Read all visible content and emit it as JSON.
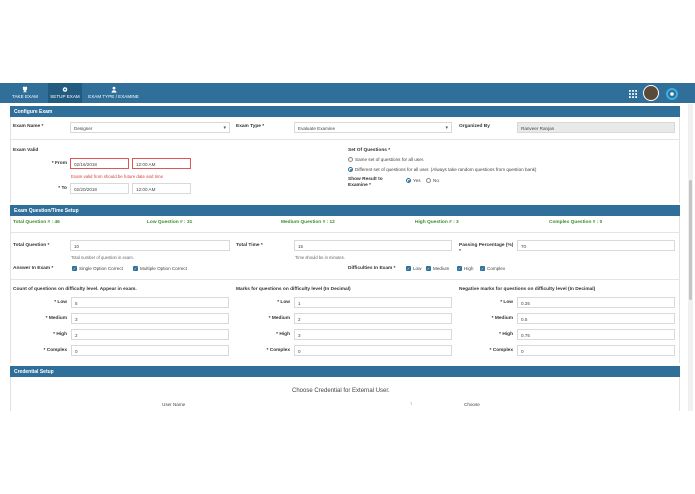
{
  "nav": {
    "tabs": [
      {
        "label": "TAKE EXAM",
        "icon": "trophy-icon"
      },
      {
        "label": "SETUP EXAM",
        "icon": "gear-icon"
      },
      {
        "label": "EXAM TYPE / EXAMINE",
        "icon": "user-icon"
      }
    ]
  },
  "configure": {
    "title": "Configure Exam",
    "exam_name_label": "Exam Name *",
    "exam_name_value": "Designer",
    "exam_type_label": "Exam Type *",
    "exam_type_value": "Evaluate Examine",
    "organized_by_label": "Organized By",
    "organized_by_value": "Ranveer Ranjan",
    "exam_valid_label": "Exam Valid",
    "from_label": "* From",
    "from_date": "02/16/2018",
    "from_time": "12:00 AM",
    "from_error": "Exam valid from should be future date and time",
    "to_label": "* To",
    "to_date": "02/20/2018",
    "to_time": "12:00 AM",
    "set_label": "Set Of Questions *",
    "set_opt1": "Same set of questions for all user.",
    "set_opt2": "Different set of questions for all user. (Always take random questions from question bank)",
    "show_result_label": "Show Result to Examine *",
    "yes": "Yes",
    "no": "No"
  },
  "question_time": {
    "title": "Exam Question/Time Setup",
    "total_q": "Total Question # : 46",
    "low_q": "Low Question # : 31",
    "medium_q": "Medium Question # : 12",
    "high_q": "High Question # : 3",
    "complex_q": "Complex Question # : 0",
    "total_question_label": "Total Question *",
    "total_question_value": "10",
    "total_question_hint": "Total number of question in exam.",
    "total_time_label": "Total Time *",
    "total_time_value": "15",
    "total_time_hint": "Time should be in minutes.",
    "passing_label": "Passing Percentage (%) *",
    "passing_value": "70",
    "answer_label": "Answer In Exam *",
    "single_option": "Single Option Correct",
    "multiple_option": "Multiple Option Correct",
    "difficulties_label": "Difficulties In Exam *",
    "diff_low": "Low",
    "diff_medium": "Medium",
    "diff_high": "High",
    "diff_complex": "Complex",
    "count_title": "Count of questions on difficulty level. Appear in exam.",
    "marks_title": "Marks for questions on difficulty level (In Decimal)",
    "neg_title": "Negative marks for questions on difficulty level (In Decimal)",
    "low_label": "* Low",
    "medium_label": "* Medium",
    "high_label": "* High",
    "complex_label": "* Complex",
    "count": {
      "low": "5",
      "medium": "3",
      "high": "2",
      "complex": "0"
    },
    "marks": {
      "low": "1",
      "medium": "2",
      "high": "3",
      "complex": "0"
    },
    "neg": {
      "low": "0.25",
      "medium": "0.5",
      "high": "0.75",
      "complex": "0"
    }
  },
  "credential": {
    "title": "Credential Setup",
    "choose_title": "Choose Credential for External User.",
    "user_name_col": "User Name",
    "choose_col": "Choose"
  },
  "colors": {
    "accent": "#2f6f9a",
    "success": "#3c8c2e",
    "error": "#d64040"
  }
}
